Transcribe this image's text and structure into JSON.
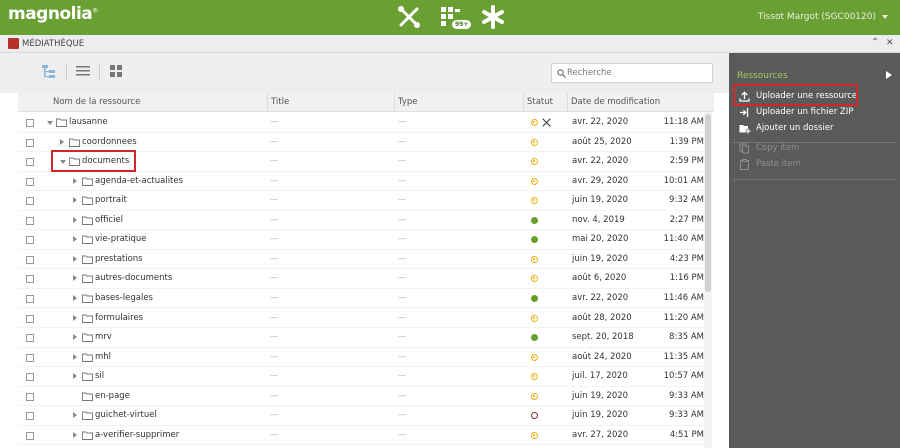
{
  "topbar": {
    "logo": "magnolia",
    "logo_mark": "®",
    "notification_count": "99+",
    "user": "Tissot Margot (SGC00120)"
  },
  "subbar": {
    "app_title": "MÉDIATHÈQUE",
    "collapse": "⌃",
    "close": "✕"
  },
  "toolbar": {
    "search_placeholder": "Recherche"
  },
  "grid": {
    "columns": {
      "name": "Nom de la ressource",
      "title": "Title",
      "type": "Type",
      "status": "Statut",
      "modified": "Date de modification"
    },
    "empty": "—",
    "rows": [
      {
        "name": "lausanne",
        "level": 0,
        "expander": "open",
        "folder": true,
        "status": "pending",
        "locked": true,
        "date": "avr. 22, 2020",
        "time": "11:18 AM"
      },
      {
        "name": "coordonnees",
        "level": 1,
        "expander": "closed",
        "folder": true,
        "status": "pending",
        "date": "août 25, 2020",
        "time": "1:39 PM"
      },
      {
        "name": "documents",
        "level": 1,
        "expander": "open",
        "folder": true,
        "status": "pending",
        "date": "avr. 22, 2020",
        "time": "2:59 PM"
      },
      {
        "name": "agenda-et-actualites",
        "level": 2,
        "expander": "closed",
        "folder": true,
        "status": "pending",
        "date": "avr. 29, 2020",
        "time": "10:01 AM"
      },
      {
        "name": "portrait",
        "level": 2,
        "expander": "closed",
        "folder": true,
        "status": "pending",
        "date": "juin 19, 2020",
        "time": "9:32 AM"
      },
      {
        "name": "officiel",
        "level": 2,
        "expander": "closed",
        "folder": true,
        "status": "published",
        "date": "nov. 4, 2019",
        "time": "2:27 PM"
      },
      {
        "name": "vie-pratique",
        "level": 2,
        "expander": "closed",
        "folder": true,
        "status": "published",
        "date": "mai 20, 2020",
        "time": "11:40 AM"
      },
      {
        "name": "prestations",
        "level": 2,
        "expander": "closed",
        "folder": true,
        "status": "pending",
        "date": "juin 19, 2020",
        "time": "4:23 PM"
      },
      {
        "name": "autres-documents",
        "level": 2,
        "expander": "closed",
        "folder": true,
        "status": "pending",
        "date": "août 6, 2020",
        "time": "1:16 PM"
      },
      {
        "name": "bases-legales",
        "level": 2,
        "expander": "closed",
        "folder": true,
        "status": "published",
        "date": "avr. 22, 2020",
        "time": "11:46 AM"
      },
      {
        "name": "formulaires",
        "level": 2,
        "expander": "closed",
        "folder": true,
        "status": "pending",
        "date": "août 28, 2020",
        "time": "11:20 AM"
      },
      {
        "name": "mrv",
        "level": 2,
        "expander": "closed",
        "folder": true,
        "status": "published",
        "date": "sept. 20, 2018",
        "time": "8:35 AM"
      },
      {
        "name": "mhl",
        "level": 2,
        "expander": "closed",
        "folder": true,
        "status": "pending",
        "date": "août 24, 2020",
        "time": "11:35 AM"
      },
      {
        "name": "sil",
        "level": 2,
        "expander": "closed",
        "folder": true,
        "status": "pending",
        "date": "juil. 17, 2020",
        "time": "10:57 AM"
      },
      {
        "name": "en-page",
        "level": 2,
        "expander": "none",
        "folder": true,
        "status": "pending",
        "date": "juin 19, 2020",
        "time": "9:33 AM"
      },
      {
        "name": "guichet-virtuel",
        "level": 2,
        "expander": "closed",
        "folder": true,
        "status": "new",
        "date": "juin 19, 2020",
        "time": "9:33 AM"
      },
      {
        "name": "a-verifier-supprimer",
        "level": 2,
        "expander": "closed",
        "folder": true,
        "status": "pending",
        "date": "avr. 27, 2020",
        "time": "4:51 PM"
      }
    ]
  },
  "panel": {
    "title": "Ressources",
    "actions": [
      {
        "label": "Uploader une ressource",
        "icon": "upload-icon",
        "enabled": true
      },
      {
        "label": "Uploader un fichier ZIP",
        "icon": "import-icon",
        "enabled": true
      },
      {
        "label": "Ajouter un dossier",
        "icon": "add-folder-icon",
        "enabled": true
      }
    ],
    "disabled_actions": [
      {
        "label": "Copy item",
        "icon": "copy-icon",
        "enabled": false
      },
      {
        "label": "Paste item",
        "icon": "paste-icon",
        "enabled": false
      }
    ]
  },
  "colors": {
    "brand_green": "#6aa033",
    "pending": "#e8b10e",
    "published": "#6a9e2b",
    "highlight": "#d3262b"
  }
}
